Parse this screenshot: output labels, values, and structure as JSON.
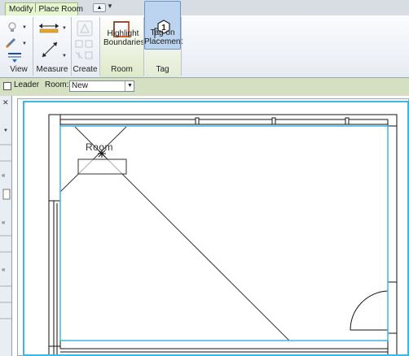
{
  "ribbon": {
    "context_tab": {
      "modify": "Modify",
      "place_room": "Place Room"
    },
    "panels": {
      "view": "View",
      "measure": "Measure",
      "create": "Create",
      "room": "Room",
      "tag": "Tag"
    },
    "buttons": {
      "highlight_line1": "Highlight",
      "highlight_line2": "Boundaries",
      "tag_line1": "Tag on",
      "tag_line2": "Placement"
    },
    "icons": {
      "qat": "window-switch-icon",
      "tag": "tag-hexagon-icon",
      "highlight": "highlight-boundaries-icon"
    }
  },
  "options_bar": {
    "leader_label": "Leader",
    "leader_checked": false,
    "room_label": "Room:",
    "room_value": "New"
  },
  "canvas": {
    "room_tag": "Room",
    "colors": {
      "crop_region": "#3db7e4",
      "options_bar": "#d4e0c1",
      "active_button": "#bcd4ef",
      "context_tab": "#e6f5cf"
    }
  }
}
